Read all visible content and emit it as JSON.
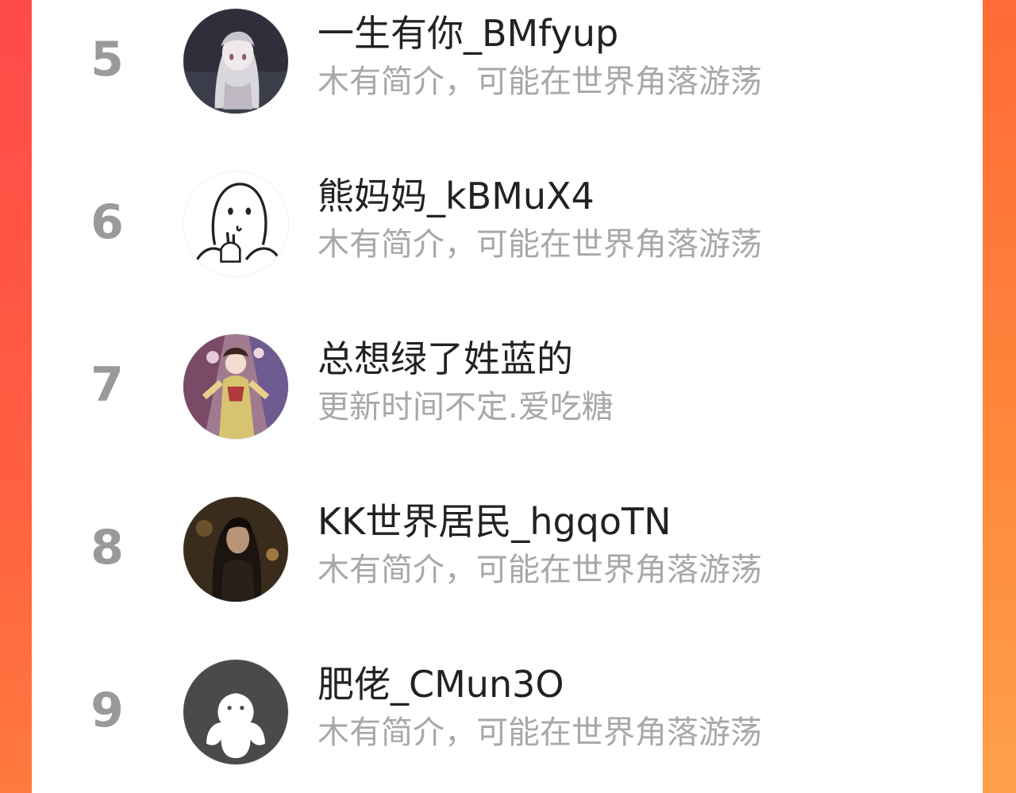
{
  "users": [
    {
      "rank": "5",
      "name": "一生有你_BMfyup",
      "bio": "木有简介，可能在世界角落游荡",
      "avatar": "anime-girl-avatar"
    },
    {
      "rank": "6",
      "name": "熊妈妈_kBMuX4",
      "bio": "木有简介，可能在世界角落游荡",
      "avatar": "doodle-ghost-avatar"
    },
    {
      "rank": "7",
      "name": "总想绿了姓蓝的",
      "bio": "更新时间不定.爱吃糖",
      "avatar": "costume-illustration-avatar"
    },
    {
      "rank": "8",
      "name": "KK世界居民_hgqoTN",
      "bio": "木有简介，可能在世界角落游荡",
      "avatar": "dark-portrait-avatar"
    },
    {
      "rank": "9",
      "name": "肥佬_CMun3O",
      "bio": "木有简介，可能在世界角落游荡",
      "avatar": "default-user-avatar"
    }
  ],
  "colors": {
    "background_gradient_top": "#ff4a4a",
    "background_gradient_bottom": "#ff9440",
    "rank_text": "#9a9a9a",
    "name_text": "#222222",
    "bio_text": "#a8a8a8"
  }
}
